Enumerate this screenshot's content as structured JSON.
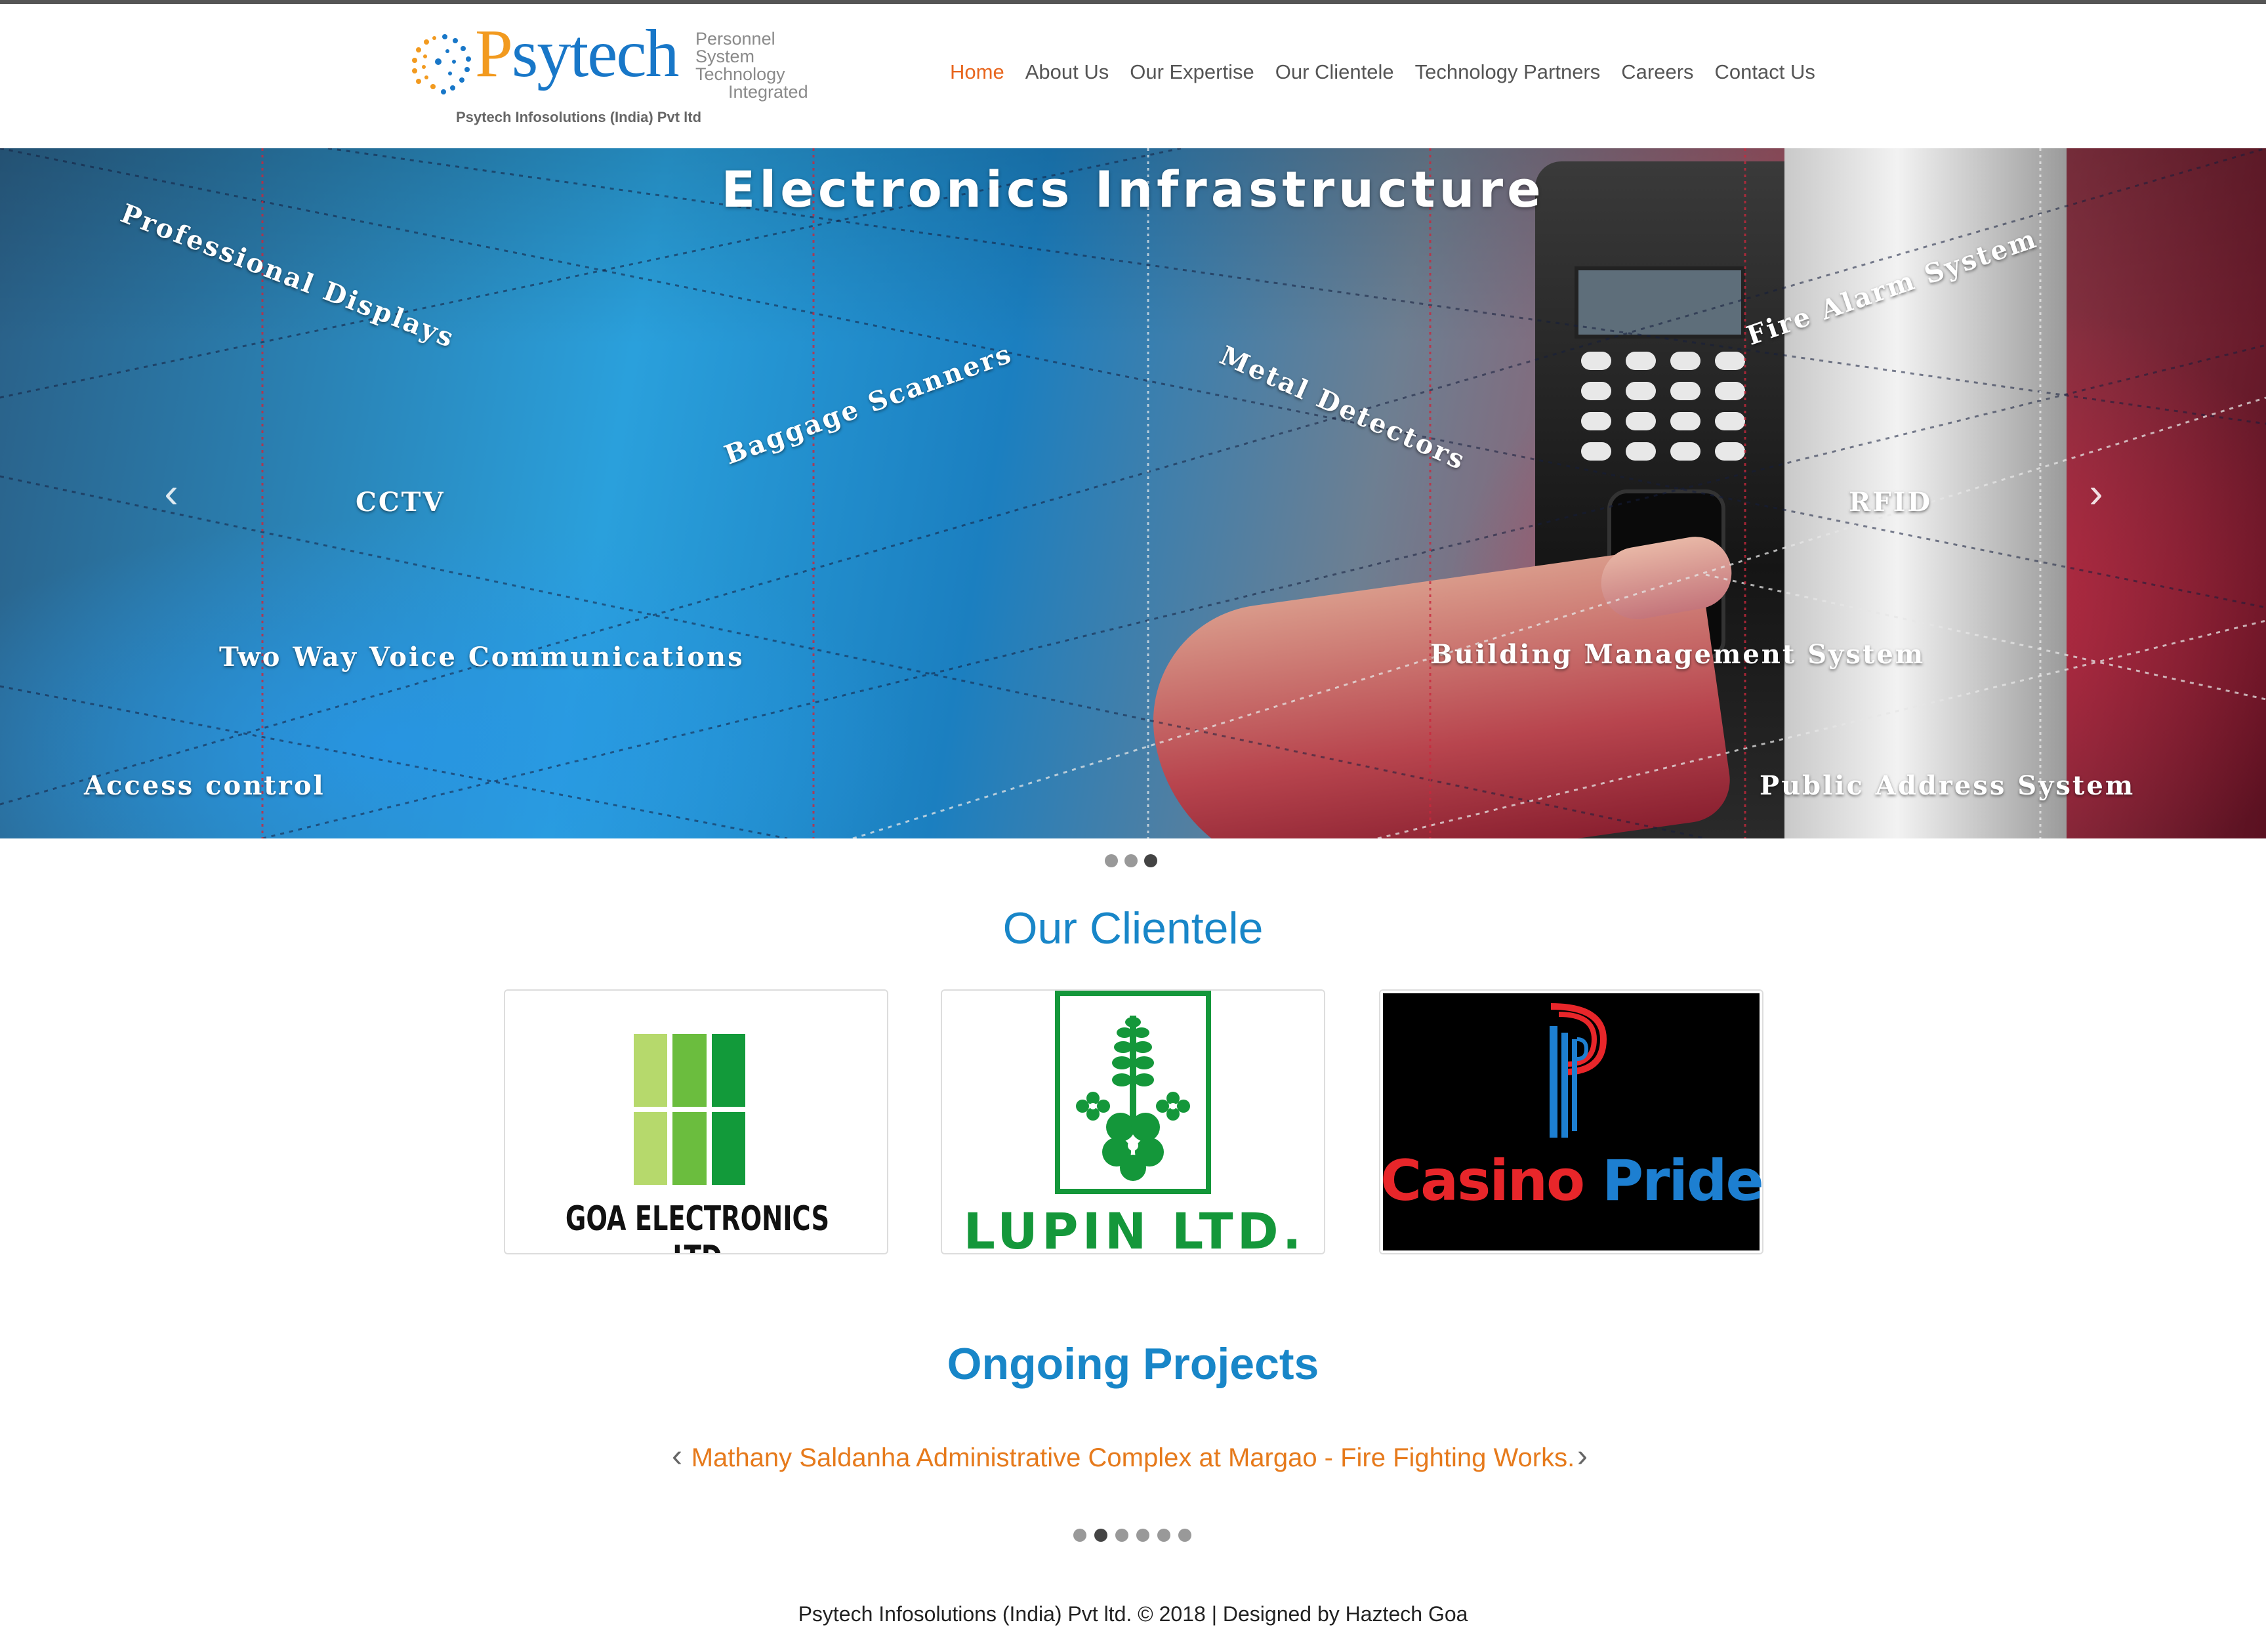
{
  "header": {
    "logo": {
      "word_first": "P",
      "word_rest": "sytech",
      "tagline": [
        "Personnel",
        "System",
        "Technology",
        "Integrated"
      ],
      "company_subtitle": "Psytech Infosolutions (India) Pvt ltd"
    },
    "nav": [
      {
        "label": "Home",
        "active": true
      },
      {
        "label": "About Us",
        "active": false
      },
      {
        "label": "Our Expertise",
        "active": false
      },
      {
        "label": "Our Clientele",
        "active": false
      },
      {
        "label": "Technology Partners",
        "active": false
      },
      {
        "label": "Careers",
        "active": false
      },
      {
        "label": "Contact Us",
        "active": false
      }
    ]
  },
  "hero": {
    "title": "Electronics Infrastructure",
    "labels": {
      "professional_displays": "Professional Displays",
      "fire_alarm": "Fire Alarm System",
      "baggage_scanners": "Baggage Scanners",
      "metal_detectors": "Metal Detectors",
      "cctv": "CCTV",
      "rfid": "RFID",
      "two_way_voice": "Two Way Voice Communications",
      "building_management": "Building Management System",
      "access_control": "Access control",
      "public_address": "Public Address System"
    },
    "prev_icon": "chevron-left-icon",
    "next_icon": "chevron-right-icon",
    "slide_count": 3,
    "active_slide": 3
  },
  "clientele": {
    "title": "Our Clientele",
    "clients": [
      {
        "name": "GOA ELECTRONICS LTD"
      },
      {
        "name": "LUPIN LTD."
      },
      {
        "name_part1": "Casino",
        "name_part2": "Pride"
      }
    ]
  },
  "projects": {
    "title": "Ongoing Projects",
    "current": "Mathany Saldanha Administrative Complex at Margao - Fire Fighting Works.",
    "slide_count": 6,
    "active_slide": 2
  },
  "footer": {
    "text": "Psytech Infosolutions (India) Pvt ltd. © 2018 | Designed by Haztech Goa"
  },
  "colors": {
    "accent_orange": "#e8661e",
    "title_blue": "#1886c8",
    "lupin_green": "#14973a"
  }
}
